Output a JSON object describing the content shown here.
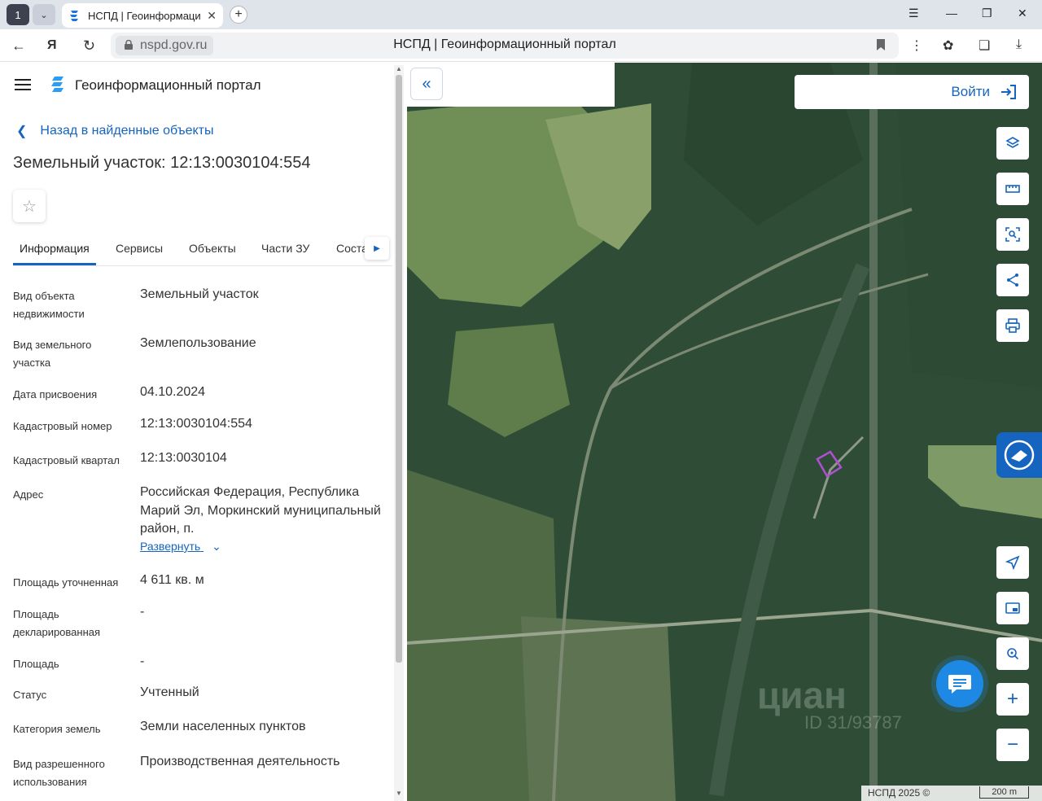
{
  "browser": {
    "tab_count": "1",
    "tab_title": "НСПД | Геоинформаци",
    "url_host": "nspd.gov.ru",
    "page_title": "НСПД | Геоинформационный портал"
  },
  "header": {
    "portal_title": "Геоинформационный портал"
  },
  "sidebar": {
    "back_label": "Назад в найденные объекты",
    "object_title": "Земельный участок: 12:13:0030104:554",
    "tabs": [
      {
        "label": "Информация"
      },
      {
        "label": "Сервисы"
      },
      {
        "label": "Объекты"
      },
      {
        "label": "Части ЗУ"
      },
      {
        "label": "Соста"
      }
    ],
    "fields": [
      {
        "label": "Вид объекта недвижимости",
        "value": "Земельный участок"
      },
      {
        "label": "Вид земельного участка",
        "value": "Землепользование"
      },
      {
        "label": "Дата присвоения",
        "value": "04.10.2024"
      },
      {
        "label": "Кадастровый номер",
        "value": "12:13:0030104:554"
      },
      {
        "label": "Кадастровый квартал",
        "value": "12:13:0030104"
      },
      {
        "label": "Адрес",
        "value": "Российская Федерация, Республика Марий Эл, Моркинский муниципальный район, п."
      },
      {
        "label": "Площадь уточненная",
        "value": "4 611 кв. м"
      },
      {
        "label": "Площадь декларированная",
        "value": "-"
      },
      {
        "label": "Площадь",
        "value": "-"
      },
      {
        "label": "Статус",
        "value": "Учтенный"
      },
      {
        "label": "Категория земель",
        "value": "Земли населенных пунктов"
      },
      {
        "label": "Вид разрешенного использования",
        "value": "Производственная деятельность"
      }
    ],
    "expand_label": "Развернуть"
  },
  "map": {
    "login_label": "Войти",
    "footer_text": "НСПД 2025 ©",
    "scale_label": "200 m",
    "watermark_text": "циан",
    "watermark_id": "ID 31/93787"
  },
  "colors": {
    "accent": "#1565c0",
    "parcel_outline": "#b04fd3"
  }
}
